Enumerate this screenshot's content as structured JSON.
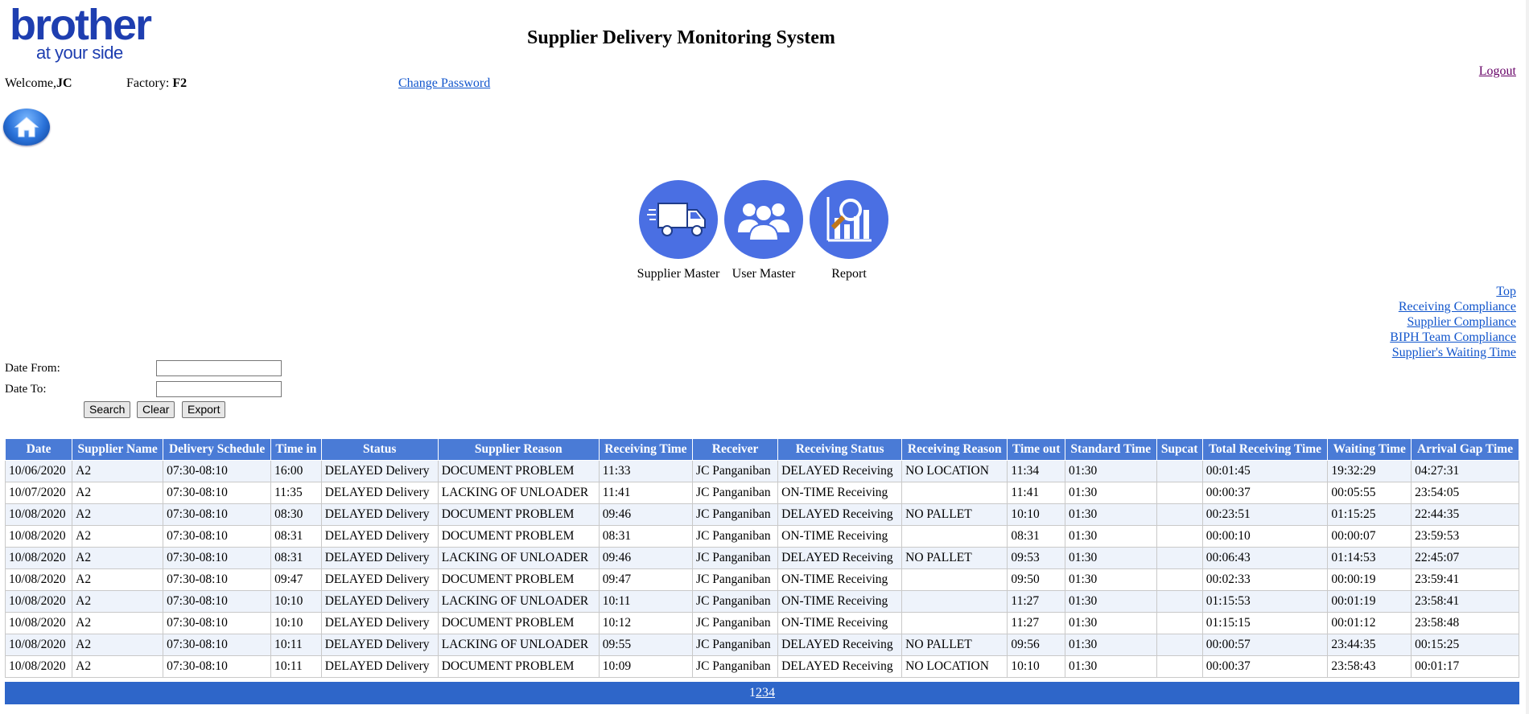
{
  "header": {
    "logo_brand": "brother",
    "logo_tagline": "at your side",
    "title": "Supplier Delivery Monitoring System",
    "welcome_prefix": "Welcome,",
    "welcome_user": "JC",
    "factory_label": "Factory: ",
    "factory_value": "F2",
    "change_password": "Change Password",
    "logout": "Logout"
  },
  "nav": [
    {
      "label": "Supplier Master",
      "icon": "truck-icon"
    },
    {
      "label": "User Master",
      "icon": "users-icon"
    },
    {
      "label": "Report",
      "icon": "report-chart-icon"
    }
  ],
  "right_links": [
    "Top",
    "Receiving Compliance",
    "Supplier Compliance",
    "BIPH Team Compliance",
    "Supplier's Waiting Time"
  ],
  "filters": {
    "date_from_label": "Date From:",
    "date_to_label": "Date To:",
    "date_from_value": "",
    "date_to_value": "",
    "search": "Search",
    "clear": "Clear",
    "export": "Export"
  },
  "table": {
    "columns": [
      "Date",
      "Supplier Name",
      "Delivery Schedule",
      "Time in",
      "Status",
      "Supplier Reason",
      "Receiving Time",
      "Receiver",
      "Receiving Status",
      "Receiving Reason",
      "Time out",
      "Standard Time",
      "Supcat",
      "Total Receiving Time",
      "Waiting Time",
      "Arrival Gap Time"
    ],
    "rows": [
      [
        "10/06/2020",
        "A2",
        "07:30-08:10",
        "16:00",
        "DELAYED Delivery",
        "DOCUMENT PROBLEM",
        "11:33",
        "JC Panganiban",
        "DELAYED Receiving",
        "NO LOCATION",
        "11:34",
        "01:30",
        "",
        "00:01:45",
        "19:32:29",
        "04:27:31"
      ],
      [
        "10/07/2020",
        "A2",
        "07:30-08:10",
        "11:35",
        "DELAYED Delivery",
        "LACKING OF UNLOADER",
        "11:41",
        "JC Panganiban",
        "ON-TIME Receiving",
        "",
        "11:41",
        "01:30",
        "",
        "00:00:37",
        "00:05:55",
        "23:54:05"
      ],
      [
        "10/08/2020",
        "A2",
        "07:30-08:10",
        "08:30",
        "DELAYED Delivery",
        "DOCUMENT PROBLEM",
        "09:46",
        "JC Panganiban",
        "DELAYED Receiving",
        "NO PALLET",
        "10:10",
        "01:30",
        "",
        "00:23:51",
        "01:15:25",
        "22:44:35"
      ],
      [
        "10/08/2020",
        "A2",
        "07:30-08:10",
        "08:31",
        "DELAYED Delivery",
        "DOCUMENT PROBLEM",
        "08:31",
        "JC Panganiban",
        "ON-TIME Receiving",
        "",
        "08:31",
        "01:30",
        "",
        "00:00:10",
        "00:00:07",
        "23:59:53"
      ],
      [
        "10/08/2020",
        "A2",
        "07:30-08:10",
        "08:31",
        "DELAYED Delivery",
        "LACKING OF UNLOADER",
        "09:46",
        "JC Panganiban",
        "DELAYED Receiving",
        "NO PALLET",
        "09:53",
        "01:30",
        "",
        "00:06:43",
        "01:14:53",
        "22:45:07"
      ],
      [
        "10/08/2020",
        "A2",
        "07:30-08:10",
        "09:47",
        "DELAYED Delivery",
        "DOCUMENT PROBLEM",
        "09:47",
        "JC Panganiban",
        "ON-TIME Receiving",
        "",
        "09:50",
        "01:30",
        "",
        "00:02:33",
        "00:00:19",
        "23:59:41"
      ],
      [
        "10/08/2020",
        "A2",
        "07:30-08:10",
        "10:10",
        "DELAYED Delivery",
        "LACKING OF UNLOADER",
        "10:11",
        "JC Panganiban",
        "ON-TIME Receiving",
        "",
        "11:27",
        "01:30",
        "",
        "01:15:53",
        "00:01:19",
        "23:58:41"
      ],
      [
        "10/08/2020",
        "A2",
        "07:30-08:10",
        "10:10",
        "DELAYED Delivery",
        "DOCUMENT PROBLEM",
        "10:12",
        "JC Panganiban",
        "ON-TIME Receiving",
        "",
        "11:27",
        "01:30",
        "",
        "01:15:15",
        "00:01:12",
        "23:58:48"
      ],
      [
        "10/08/2020",
        "A2",
        "07:30-08:10",
        "10:11",
        "DELAYED Delivery",
        "LACKING OF UNLOADER",
        "09:55",
        "JC Panganiban",
        "DELAYED Receiving",
        "NO PALLET",
        "09:56",
        "01:30",
        "",
        "00:00:57",
        "23:44:35",
        "00:15:25"
      ],
      [
        "10/08/2020",
        "A2",
        "07:30-08:10",
        "10:11",
        "DELAYED Delivery",
        "DOCUMENT PROBLEM",
        "10:09",
        "JC Panganiban",
        "DELAYED Receiving",
        "NO LOCATION",
        "10:10",
        "01:30",
        "",
        "00:00:37",
        "23:58:43",
        "00:01:17"
      ]
    ]
  },
  "pager": {
    "current": "1",
    "pages": [
      "2",
      "3",
      "4"
    ]
  },
  "colors": {
    "header_blue": "#4a7bd6",
    "pager_blue": "#2e66c9",
    "nav_circle": "#4a6fe3",
    "brand": "#1e3eb0"
  }
}
